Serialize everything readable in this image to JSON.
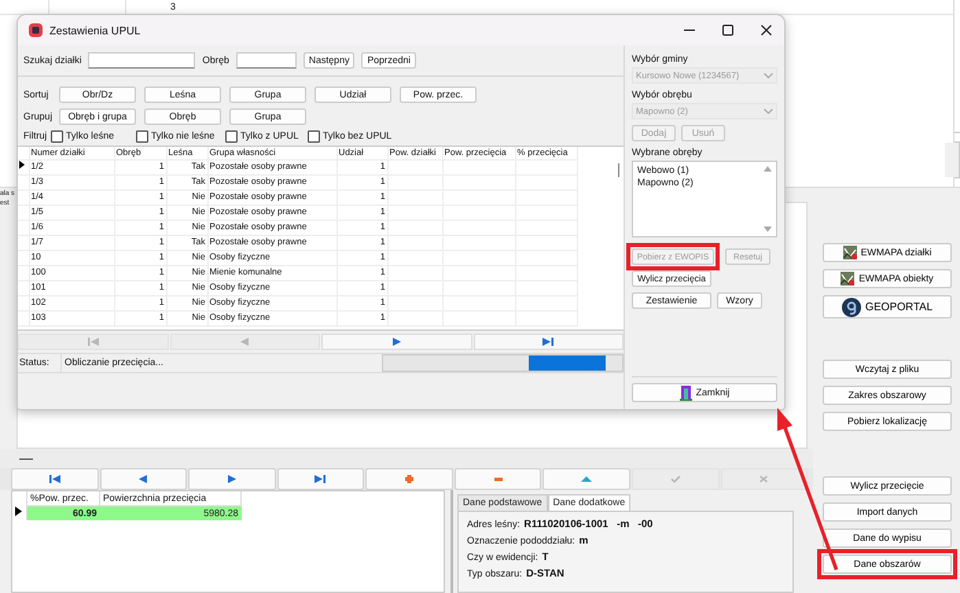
{
  "background": {
    "cell_value": "3",
    "left_texts": [
      "ala s",
      "est"
    ]
  },
  "dialog": {
    "title": "Zestawienia UPUL",
    "search": {
      "label": "Szukaj działki",
      "area_label": "Obręb",
      "buttons": [
        "Następny",
        "Poprzedni"
      ]
    },
    "sort": {
      "label": "Sortuj",
      "buttons": [
        "Obr/Dz",
        "Leśna",
        "Grupa",
        "Udział",
        "Pow. przec."
      ]
    },
    "group": {
      "label": "Grupuj",
      "buttons": [
        "Obręb i grupa",
        "Obręb",
        "Grupa"
      ]
    },
    "filter": {
      "label": "Filtruj",
      "options": [
        {
          "label": "Tylko leśne",
          "checked": false
        },
        {
          "label": "Tylko nie leśne",
          "checked": false
        },
        {
          "label": "Tylko z UPUL",
          "checked": false
        },
        {
          "label": "Tylko bez UPUL",
          "checked": false
        }
      ]
    },
    "table": {
      "columns": [
        "Numer działki",
        "Obręb",
        "Leśna",
        "Grupa własności",
        "Udział",
        "Pow. działki",
        "Pow. przecięcia",
        "% przecięcia"
      ],
      "rows": [
        {
          "cells": [
            "1/2",
            "1",
            "Tak",
            "Pozostałe osoby prawne",
            "1",
            "",
            "",
            ""
          ],
          "current": true
        },
        {
          "cells": [
            "1/3",
            "1",
            "Tak",
            "Pozostałe osoby prawne",
            "1",
            "",
            "",
            ""
          ],
          "current": false
        },
        {
          "cells": [
            "1/4",
            "1",
            "Nie",
            "Pozostałe osoby prawne",
            "1",
            "",
            "",
            ""
          ],
          "current": false
        },
        {
          "cells": [
            "1/5",
            "1",
            "Nie",
            "Pozostałe osoby prawne",
            "1",
            "",
            "",
            ""
          ],
          "current": false
        },
        {
          "cells": [
            "1/6",
            "1",
            "Nie",
            "Pozostałe osoby prawne",
            "1",
            "",
            "",
            ""
          ],
          "current": false
        },
        {
          "cells": [
            "1/7",
            "1",
            "Tak",
            "Pozostałe osoby prawne",
            "1",
            "",
            "",
            ""
          ],
          "current": false
        },
        {
          "cells": [
            "10",
            "1",
            "Nie",
            "Osoby fizyczne",
            "1",
            "",
            "",
            ""
          ],
          "current": false
        },
        {
          "cells": [
            "100",
            "1",
            "Nie",
            "Mienie komunalne",
            "1",
            "",
            "",
            ""
          ],
          "current": false
        },
        {
          "cells": [
            "101",
            "1",
            "Nie",
            "Osoby fizyczne",
            "1",
            "",
            "",
            ""
          ],
          "current": false
        },
        {
          "cells": [
            "102",
            "1",
            "Nie",
            "Osoby fizyczne",
            "1",
            "",
            "",
            ""
          ],
          "current": false
        },
        {
          "cells": [
            "103",
            "1",
            "Nie",
            "Osoby fizyczne",
            "1",
            "",
            "",
            ""
          ],
          "current": false
        }
      ]
    },
    "nav": [
      {
        "kind": "first",
        "disabled": true
      },
      {
        "kind": "prior",
        "disabled": true
      },
      {
        "kind": "next",
        "disabled": false
      },
      {
        "kind": "last",
        "disabled": false
      }
    ],
    "status": {
      "label": "Status:",
      "text": "Obliczanie przecięcia..."
    },
    "side": {
      "commune_label": "Wybór gminy",
      "commune_value": "Kursowo Nowe (1234567)",
      "precinct_label": "Wybór obrębu",
      "precinct_value": "Mapowno (2)",
      "add_button": {
        "label": "Dodaj",
        "disabled": true
      },
      "remove_button": {
        "label": "Usuń",
        "disabled": true
      },
      "chosen_label": "Wybrane obręby",
      "chosen": [
        "Webowo (1)",
        "Mapowno (2)"
      ],
      "fetch_button": {
        "label": "Pobierz z EWOPIS",
        "disabled": true,
        "highlighted": true
      },
      "reset_button": {
        "label": "Resetuj",
        "disabled": true
      },
      "compute_button": "Wylicz przecięcia",
      "summary_button": "Zestawienie",
      "templates_button": "Wzory",
      "close_button": "Zamknij"
    }
  },
  "nav_bar": [
    {
      "kind": "first",
      "disabled": false
    },
    {
      "kind": "prior",
      "disabled": false
    },
    {
      "kind": "next",
      "disabled": false
    },
    {
      "kind": "last",
      "disabled": false
    },
    {
      "kind": "insert",
      "disabled": false
    },
    {
      "kind": "delete",
      "disabled": false
    },
    {
      "kind": "edit",
      "disabled": false
    },
    {
      "kind": "post",
      "disabled": true
    },
    {
      "kind": "cancel",
      "disabled": true
    }
  ],
  "results": {
    "columns": [
      "%Pow. przec.",
      "Powierzchnia przecięcia"
    ],
    "rows": [
      {
        "cells": [
          "60.99",
          "5980.28"
        ],
        "current": true
      }
    ]
  },
  "details": {
    "tabs": [
      {
        "label": "Dane podstawowe",
        "selected": false
      },
      {
        "label": "Dane dodatkowe",
        "selected": true
      }
    ],
    "fields": [
      {
        "label": "Adres leśny:",
        "value": "R111020106-1001   -m   -00"
      },
      {
        "label": "Oznaczenie pododdziału:",
        "value": "m"
      },
      {
        "label": "Czy w ewidencji:",
        "value": "T"
      },
      {
        "label": "Typ obszaru:",
        "value": "D-STAN"
      }
    ]
  },
  "side_buttons": [
    [
      {
        "label": "EWMAPA działki",
        "kind": "ewmapa",
        "highlighted": false
      },
      {
        "label": "EWMAPA obiekty",
        "kind": "ewmapa",
        "highlighted": false
      },
      {
        "label": "GEOPORTAL",
        "kind": "geoportal",
        "highlighted": false
      }
    ],
    [
      {
        "label": "Wczytaj z pliku",
        "kind": "plain",
        "highlighted": false
      },
      {
        "label": "Zakres obszarowy",
        "kind": "plain",
        "highlighted": false
      },
      {
        "label": "Pobierz lokalizację",
        "kind": "plain",
        "highlighted": false
      }
    ],
    [
      {
        "label": "Wylicz przecięcie",
        "kind": "plain",
        "highlighted": false
      },
      {
        "label": "Import danych",
        "kind": "plain",
        "highlighted": false
      },
      {
        "label": "Dane do wypisu",
        "kind": "plain",
        "highlighted": false
      },
      {
        "label": "Dane obszarów",
        "kind": "plain",
        "highlighted": true
      }
    ]
  ],
  "annotation_arrow": true
}
